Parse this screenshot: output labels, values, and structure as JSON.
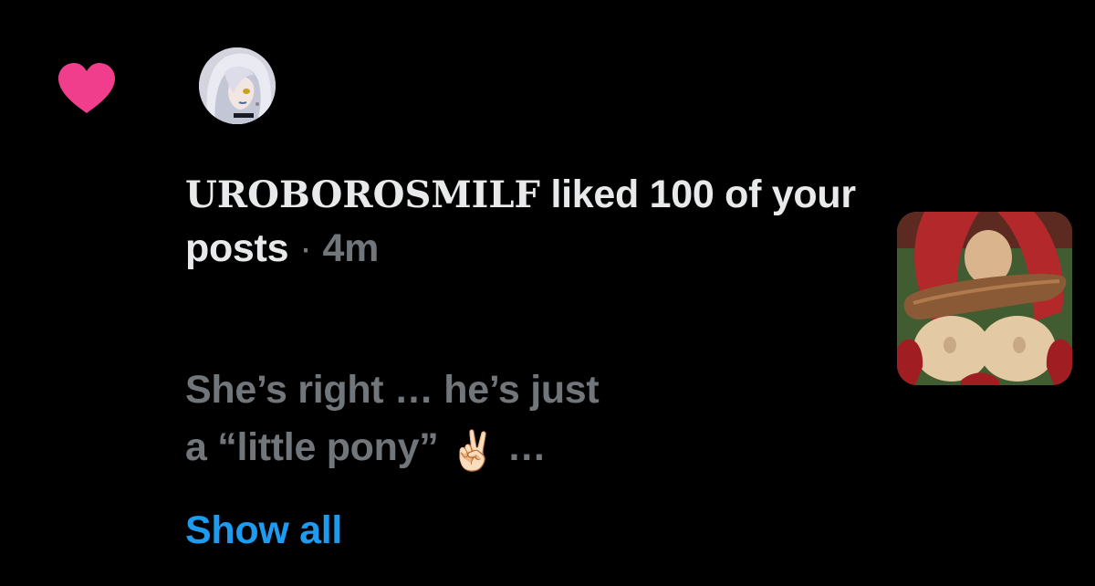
{
  "notification": {
    "icon": "heart-icon",
    "username": "UROBOROSMILF",
    "action": "liked 100 of your posts",
    "separator": "·",
    "time": "4m",
    "post_line_1": "She’s right … he’s just",
    "post_line_2": "a “little pony”",
    "post_emoji": "✌🏻",
    "post_ellipsis": "…",
    "show_all": "Show all"
  },
  "colors": {
    "background": "#000000",
    "heart": "#f03e8c",
    "primary_text": "#e7e9ea",
    "secondary_text": "#71767b",
    "link": "#1d9bf0"
  }
}
